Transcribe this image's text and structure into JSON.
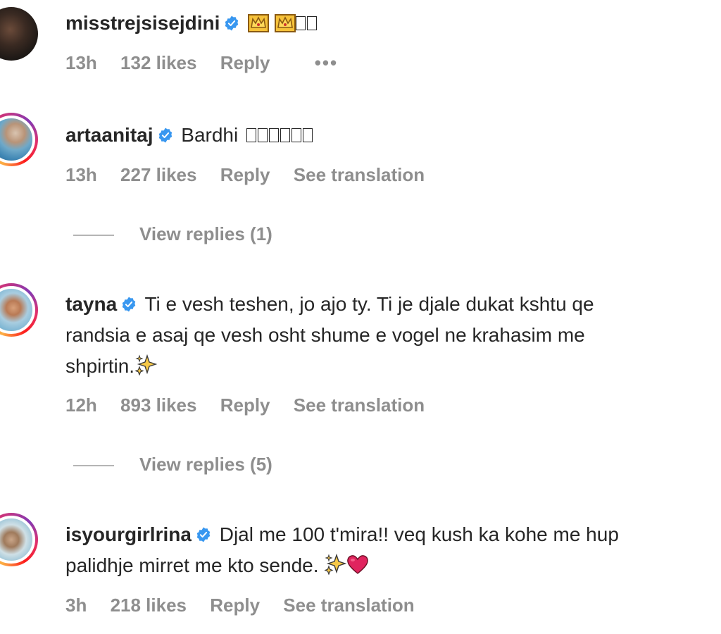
{
  "comments": [
    {
      "username": "misstrejsisejdini",
      "verified": true,
      "text": "",
      "emoji": [
        "crown",
        "crown",
        "tofu",
        "tofu"
      ],
      "time": "13h",
      "likes": "132 likes",
      "reply": "Reply",
      "more": "•••"
    },
    {
      "username": "artaanitaj",
      "verified": true,
      "text": "Bardhi",
      "emoji": [
        "tofu",
        "tofu",
        "tofu",
        "tofu",
        "tofu",
        "tofu"
      ],
      "time": "13h",
      "likes": "227 likes",
      "reply": "Reply",
      "translate": "See translation",
      "view_replies": "View replies (1)"
    },
    {
      "username": "tayna",
      "verified": true,
      "text_line1": "Ti e vesh teshen, jo ajo ty. Ti je djale dukat kshtu qe",
      "text_line2": "randsia e asaj qe vesh osht shume e vogel ne krahasim me",
      "text_line3": "shpirtin.",
      "time": "12h",
      "likes": "893 likes",
      "reply": "Reply",
      "translate": "See translation",
      "view_replies": "View replies (5)"
    },
    {
      "username": "isyourgirlrina",
      "verified": true,
      "text_line1": "Djal me 100 t'mira!! veq kush ka kohe me hup",
      "text_line2": "palidhje mirret me kto sende.",
      "time": "3h",
      "likes": "218 likes",
      "reply": "Reply",
      "translate": "See translation"
    }
  ],
  "colors": {
    "text": "#262626",
    "muted": "#8e8e8e",
    "verified": "#3897f0",
    "heart": "#e0245e"
  }
}
